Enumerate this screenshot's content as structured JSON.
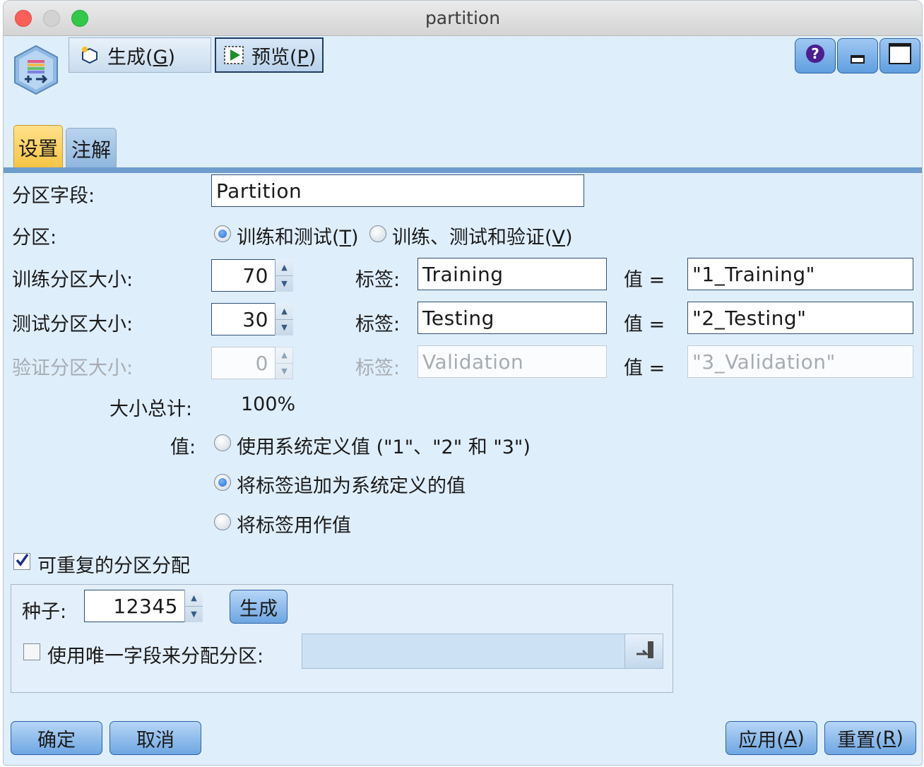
{
  "window": {
    "title": "partition"
  },
  "toolbar": {
    "generate_label": "生成(",
    "generate_key": "G",
    "generate_end": ")",
    "preview_label": "预览(",
    "preview_key": "P",
    "preview_end": ")"
  },
  "tabs": [
    {
      "label": "设置"
    },
    {
      "label": "注解"
    }
  ],
  "form": {
    "partition_field": {
      "label": "分区字段:",
      "value": "Partition"
    },
    "partition": {
      "label": "分区:",
      "options": [
        {
          "label": "训练和测试(",
          "key": "T",
          "end": ")",
          "selected": true
        },
        {
          "label": "训练、测试和验证(",
          "key": "V",
          "end": ")",
          "selected": false
        }
      ]
    },
    "rows": [
      {
        "label": "训练分区大小:",
        "size": "70",
        "tag_label": "标签:",
        "tag": "Training",
        "eq": "值 =",
        "value": "\"1_Training\"",
        "enabled": true
      },
      {
        "label": "测试分区大小:",
        "size": "30",
        "tag_label": "标签:",
        "tag": "Testing",
        "eq": "值 =",
        "value": "\"2_Testing\"",
        "enabled": true
      },
      {
        "label": "验证分区大小:",
        "size": "0",
        "tag_label": "标签:",
        "tag": "Validation",
        "eq": "值 =",
        "value": "\"3_Validation\"",
        "enabled": false
      }
    ],
    "total": {
      "label": "大小总计:",
      "value": "100%"
    },
    "values": {
      "label": "值:",
      "options": [
        {
          "label": "使用系统定义值 (\"1\"、\"2\" 和 \"3\")",
          "selected": false
        },
        {
          "label": "将标签追加为系统定义的值",
          "selected": true
        },
        {
          "label": "将标签用作值",
          "selected": false
        }
      ]
    },
    "repeatable": {
      "label": "可重复的分区分配",
      "checked": true
    },
    "seed": {
      "label": "种子:",
      "value": "12345",
      "generate_label": "生成"
    },
    "unique_field": {
      "label": "使用唯一字段来分配分区:",
      "checked": false,
      "value": ""
    }
  },
  "buttons": {
    "ok": "确定",
    "cancel": "取消",
    "apply": "应用(",
    "apply_key": "A",
    "apply_end": ")",
    "reset": "重置(",
    "reset_key": "R",
    "reset_end": ")"
  },
  "colors": {
    "accent": "#6ea6e2",
    "background": "#dfeefb",
    "tab_active": "#f6c443"
  }
}
